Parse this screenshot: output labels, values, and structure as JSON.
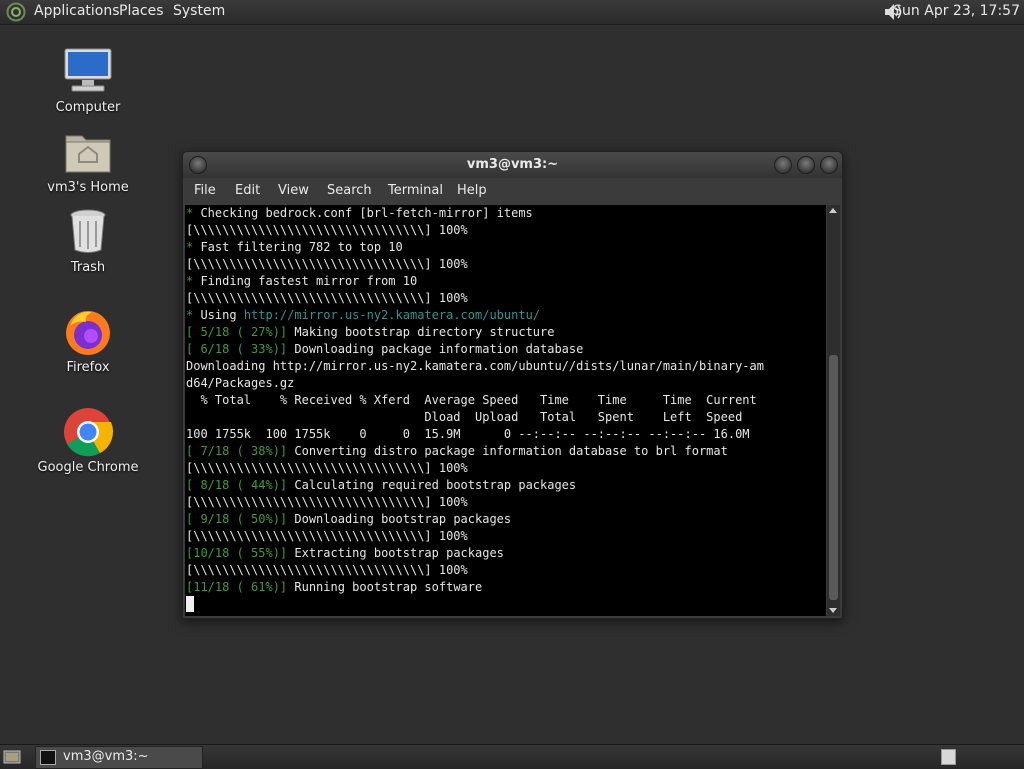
{
  "top_panel": {
    "menus": [
      "Applications",
      "Places",
      "System"
    ],
    "clock": "Sun Apr 23, 17:57"
  },
  "desktop": {
    "icons": [
      {
        "label": "Computer",
        "icon": "computer-icon"
      },
      {
        "label": "vm3's Home",
        "icon": "home-folder-icon"
      },
      {
        "label": "Trash",
        "icon": "trash-icon"
      },
      {
        "label": "Firefox",
        "icon": "firefox-icon"
      },
      {
        "label": "Google Chrome",
        "icon": "chrome-icon"
      }
    ]
  },
  "window": {
    "title": "vm3@vm3:~",
    "menu": [
      "File",
      "Edit",
      "View",
      "Search",
      "Terminal",
      "Help"
    ]
  },
  "terminal": {
    "lines": [
      [
        {
          "t": "* ",
          "c": "dim"
        },
        {
          "t": "Checking bedrock.conf [brl-fetch-mirror] items"
        }
      ],
      [
        {
          "t": "[\\\\\\\\\\\\\\\\\\\\\\\\\\\\\\\\\\\\\\\\\\\\\\\\\\\\\\\\\\\\\\\\] 100%"
        }
      ],
      [
        {
          "t": "* ",
          "c": "dim"
        },
        {
          "t": "Fast filtering 782 to top 10"
        }
      ],
      [
        {
          "t": "[\\\\\\\\\\\\\\\\\\\\\\\\\\\\\\\\\\\\\\\\\\\\\\\\\\\\\\\\\\\\\\\\] 100%"
        }
      ],
      [
        {
          "t": "* ",
          "c": "dim"
        },
        {
          "t": "Finding fastest mirror from 10"
        }
      ],
      [
        {
          "t": "[\\\\\\\\\\\\\\\\\\\\\\\\\\\\\\\\\\\\\\\\\\\\\\\\\\\\\\\\\\\\\\\\] 100%"
        }
      ],
      [
        {
          "t": "* ",
          "c": "dim"
        },
        {
          "t": "Using "
        },
        {
          "t": "http://mirror.us-ny2.kamatera.com/ubuntu/",
          "c": "url"
        }
      ],
      [
        {
          "t": "[ 5/18 ( 27%)] ",
          "c": "dim"
        },
        {
          "t": "Making bootstrap directory structure"
        }
      ],
      [
        {
          "t": "[ 6/18 ( 33%)] ",
          "c": "dim"
        },
        {
          "t": "Downloading package information database"
        }
      ],
      [
        {
          "t": "Downloading http://mirror.us-ny2.kamatera.com/ubuntu//dists/lunar/main/binary-am"
        }
      ],
      [
        {
          "t": "d64/Packages.gz"
        }
      ],
      [
        {
          "t": "  % Total    % Received % Xferd  Average Speed   Time    Time     Time  Current"
        }
      ],
      [
        {
          "t": "                                 Dload  Upload   Total   Spent    Left  Speed"
        }
      ],
      [
        {
          "t": "100 1755k  100 1755k    0     0  15.9M      0 --:--:-- --:--:-- --:--:-- 16.0M"
        }
      ],
      [
        {
          "t": "[ 7/18 ( 38%)] ",
          "c": "dim"
        },
        {
          "t": "Converting distro package information database to brl format"
        }
      ],
      [
        {
          "t": "[\\\\\\\\\\\\\\\\\\\\\\\\\\\\\\\\\\\\\\\\\\\\\\\\\\\\\\\\\\\\\\\\] 100%"
        }
      ],
      [
        {
          "t": "[ 8/18 ( 44%)] ",
          "c": "dim"
        },
        {
          "t": "Calculating required bootstrap packages"
        }
      ],
      [
        {
          "t": "[\\\\\\\\\\\\\\\\\\\\\\\\\\\\\\\\\\\\\\\\\\\\\\\\\\\\\\\\\\\\\\\\] 100%"
        }
      ],
      [
        {
          "t": "[ 9/18 ( 50%)] ",
          "c": "dim"
        },
        {
          "t": "Downloading bootstrap packages"
        }
      ],
      [
        {
          "t": "[\\\\\\\\\\\\\\\\\\\\\\\\\\\\\\\\\\\\\\\\\\\\\\\\\\\\\\\\\\\\\\\\] 100%"
        }
      ],
      [
        {
          "t": "[10/18 ( 55%)] ",
          "c": "dim"
        },
        {
          "t": "Extracting bootstrap packages"
        }
      ],
      [
        {
          "t": "[\\\\\\\\\\\\\\\\\\\\\\\\\\\\\\\\\\\\\\\\\\\\\\\\\\\\\\\\\\\\\\\\] 100%"
        }
      ],
      [
        {
          "t": "[11/18 ( 61%)] ",
          "c": "dim"
        },
        {
          "t": "Running bootstrap software"
        }
      ]
    ]
  },
  "taskbar": {
    "task_label": "vm3@vm3:~"
  }
}
